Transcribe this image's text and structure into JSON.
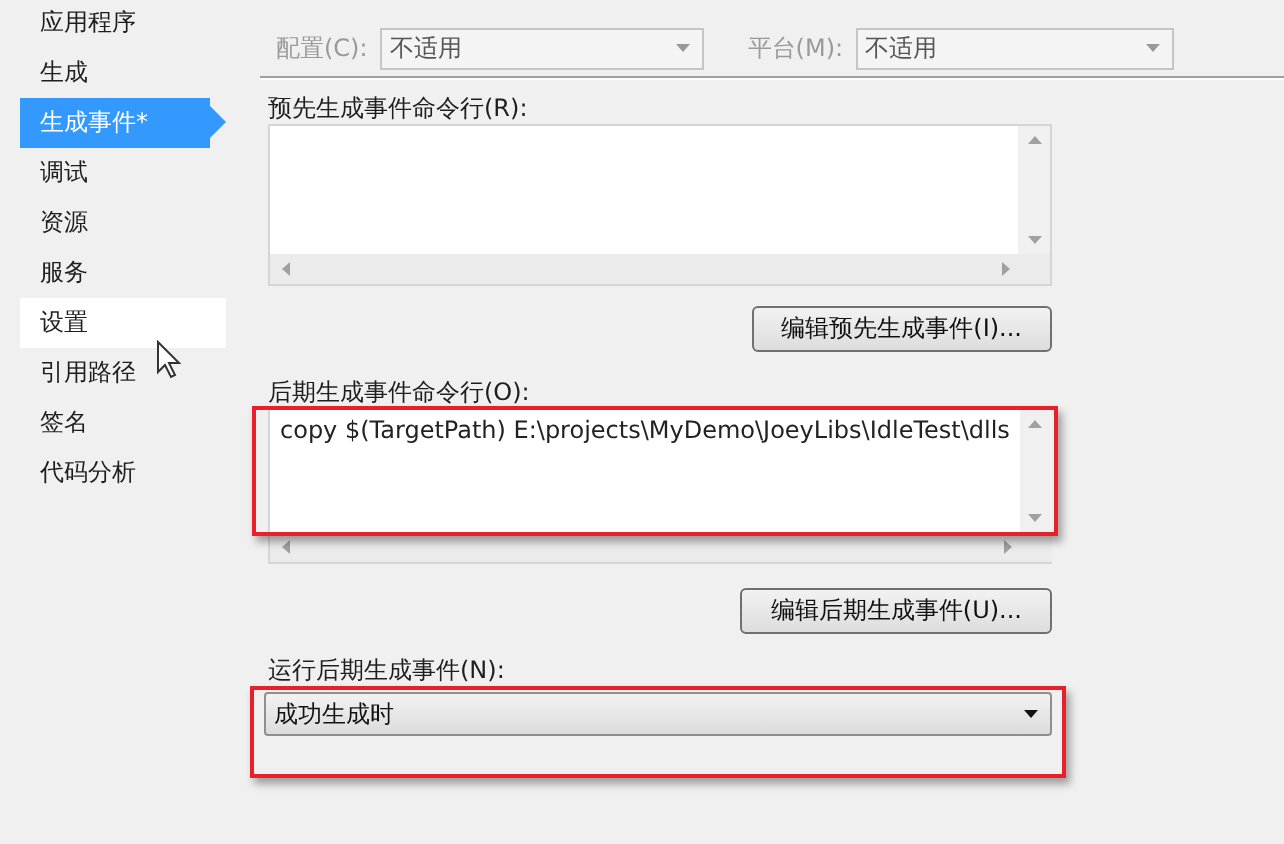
{
  "sidebar": {
    "items": [
      {
        "label": "应用程序",
        "selected": false,
        "hovered": false
      },
      {
        "label": "生成",
        "selected": false,
        "hovered": false
      },
      {
        "label": "生成事件*",
        "selected": true,
        "hovered": false
      },
      {
        "label": "调试",
        "selected": false,
        "hovered": false
      },
      {
        "label": "资源",
        "selected": false,
        "hovered": false
      },
      {
        "label": "服务",
        "selected": false,
        "hovered": false
      },
      {
        "label": "设置",
        "selected": false,
        "hovered": true
      },
      {
        "label": "引用路径",
        "selected": false,
        "hovered": false
      },
      {
        "label": "签名",
        "selected": false,
        "hovered": false
      },
      {
        "label": "代码分析",
        "selected": false,
        "hovered": false
      }
    ]
  },
  "configuration": {
    "label": "配置(C):",
    "value": "不适用",
    "disabled": true
  },
  "platform": {
    "label": "平台(M):",
    "value": "不适用",
    "disabled": true
  },
  "pre_build": {
    "label": "预先生成事件命令行(R):",
    "highlighted": false,
    "button": "编辑预先生成事件(I)..."
  },
  "post_build": {
    "label": "后期生成事件命令行(O):",
    "value": "copy $(TargetPath) E:\\projects\\MyDemo\\JoeyLibs\\IdleTest\\dlls",
    "highlighted": true,
    "button": "编辑后期生成事件(U)..."
  },
  "run_post_build": {
    "label": "运行后期生成事件(N):",
    "value": "成功生成时",
    "highlighted": true
  }
}
